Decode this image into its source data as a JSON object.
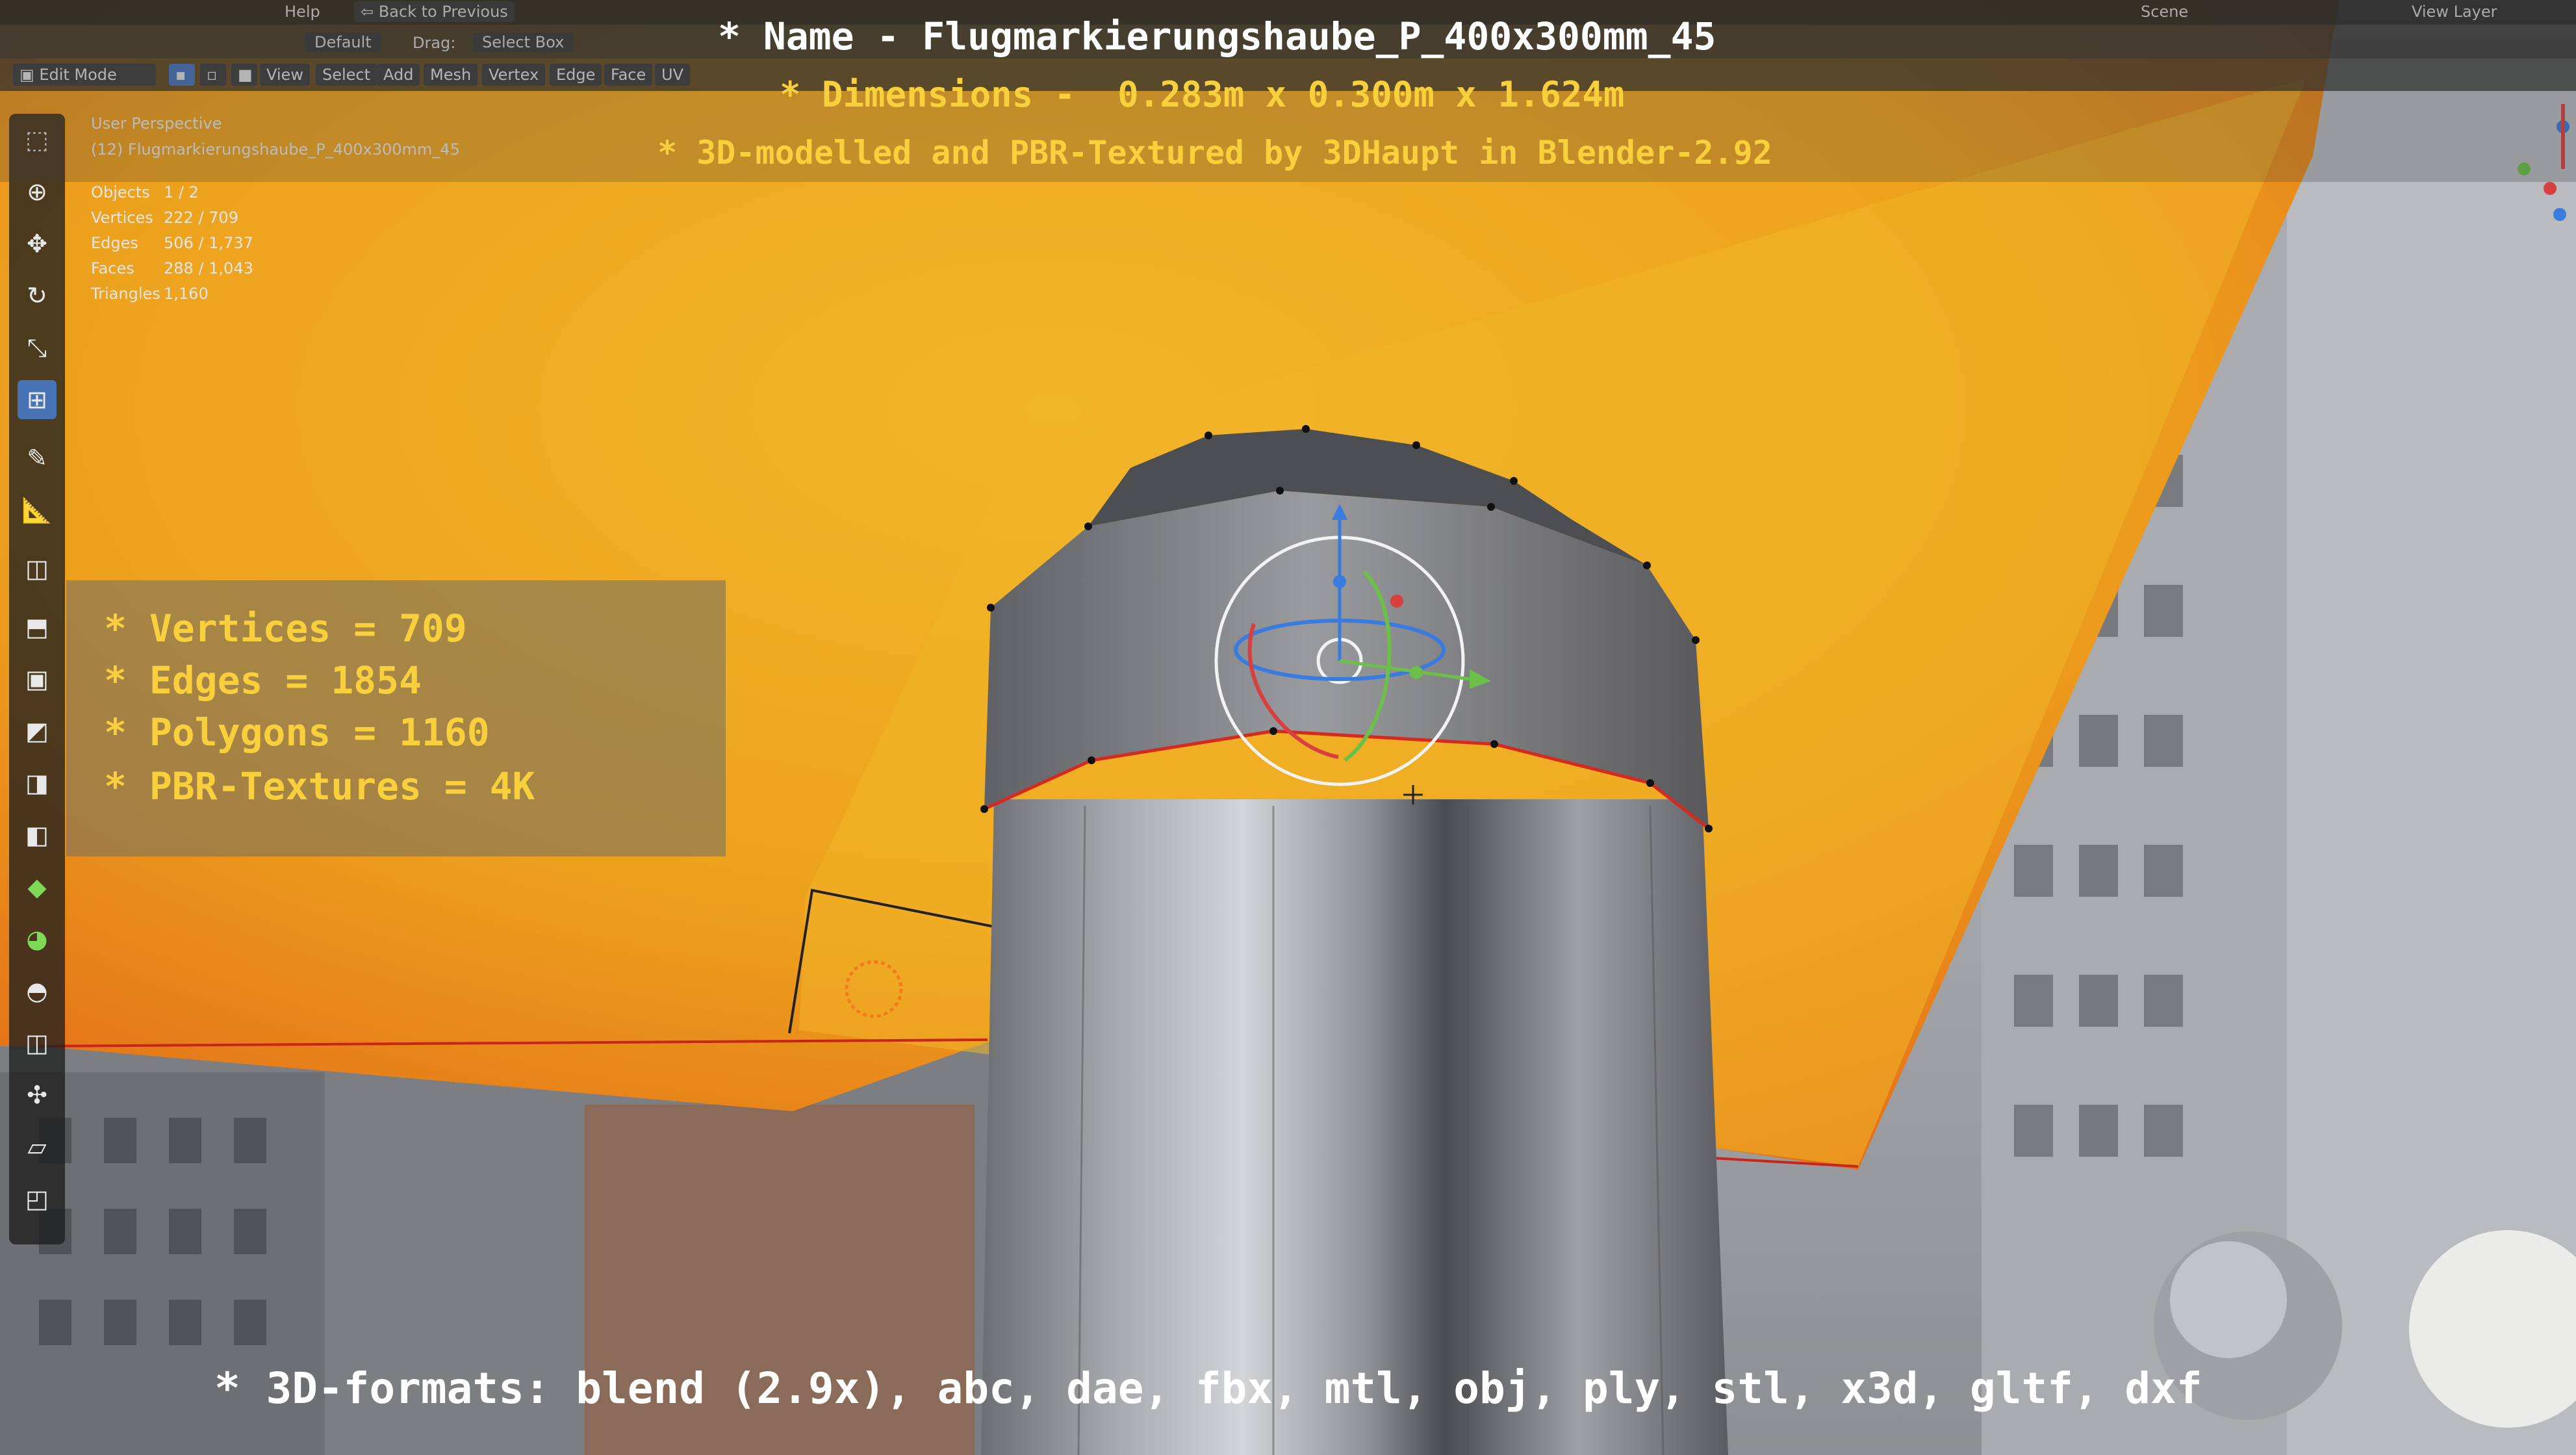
{
  "window": {
    "menu_help": "Help",
    "back_to_previous": "Back to Previous",
    "scene_label": "Scene",
    "view_layer_label": "View Layer"
  },
  "header": {
    "mode": "Edit Mode",
    "transform_orientation": "Default",
    "drag_label": "Drag:",
    "drag_value": "Select Box",
    "menus": [
      "View",
      "Select",
      "Add",
      "Mesh",
      "Vertex",
      "Edge",
      "Face",
      "UV"
    ]
  },
  "viewport": {
    "perspective": "User Perspective",
    "object_name": "(12) Flugmarkierungshaube_P_400x300mm_45",
    "stats": [
      {
        "label": "Objects",
        "value": "1 / 2"
      },
      {
        "label": "Vertices",
        "value": "222 / 709"
      },
      {
        "label": "Edges",
        "value": "506 / 1,737"
      },
      {
        "label": "Faces",
        "value": "288 / 1,043"
      },
      {
        "label": "Triangles",
        "value": "1,160"
      }
    ]
  },
  "overlay": {
    "name_line": "* Name - Flugmarkierungshaube_P_400x300mm_45",
    "dimensions_line": "* Dimensions -  0.283m x 0.300m x 1.624m",
    "author_line": "* 3D-modelled and PBR-Textured by 3DHaupt in Blender-2.92",
    "stats_lines": [
      "* Vertices = 709",
      "* Edges = 1854",
      "* Polygons = 1160",
      "* PBR-Textures = 4K"
    ],
    "formats_line": "* 3D-formats: blend (2.9x), abc, dae, fbx, mtl, obj, ply, stl, x3d, gltf, dxf"
  },
  "colors": {
    "title_white": "#ffffff",
    "title_yellow": "#f8cf3d",
    "tool_active": "#4772b3",
    "cover_yellow": "#f3ad22",
    "cover_orange": "#e06a15"
  }
}
